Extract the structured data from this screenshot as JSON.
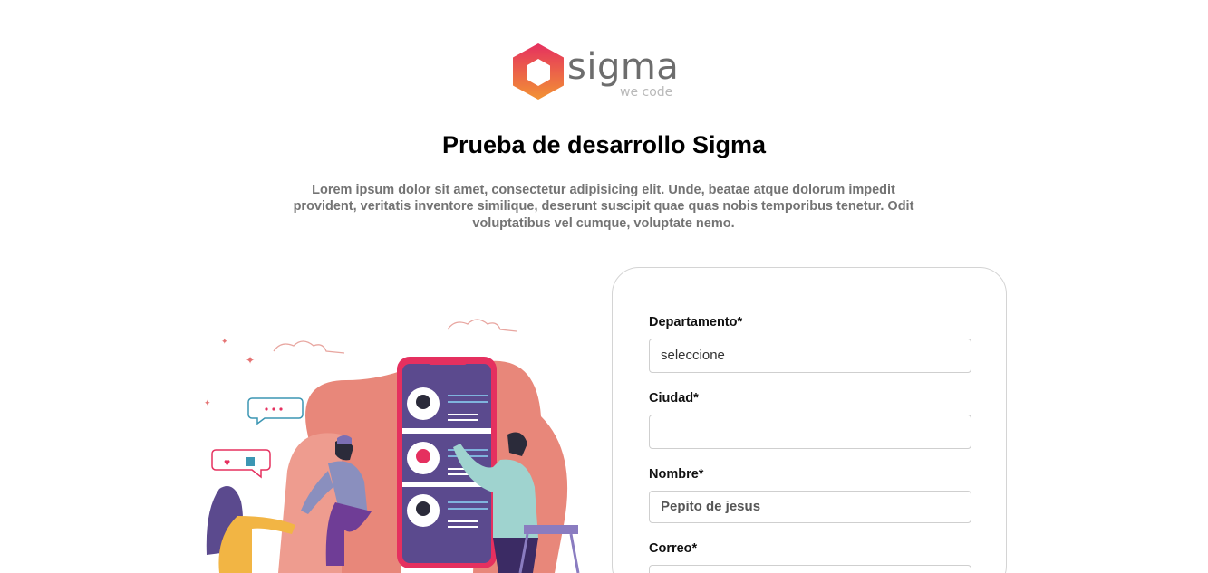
{
  "brand": {
    "name": "sigma",
    "tagline": "we code",
    "colors": {
      "gradient_start": "#e5305f",
      "gradient_end": "#f29334",
      "word": "#6d6d6d"
    }
  },
  "header": {
    "title": "Prueba de desarrollo Sigma",
    "description": "Lorem ipsum dolor sit amet, consectetur adipisicing elit. Unde, beatae atque dolorum impedit provident, veritatis inventore similique, deserunt suscipit quae quas nobis temporibus tenetur. Odit voluptatibus vel cumque, voluptate nemo."
  },
  "illustration": {
    "icon": "people-phone-illustration"
  },
  "form": {
    "departamento": {
      "label": "Departamento*",
      "value": "seleccione"
    },
    "ciudad": {
      "label": "Ciudad*",
      "value": ""
    },
    "nombre": {
      "label": "Nombre*",
      "value": "Pepito de jesus"
    },
    "correo": {
      "label": "Correo*",
      "value": ""
    }
  }
}
